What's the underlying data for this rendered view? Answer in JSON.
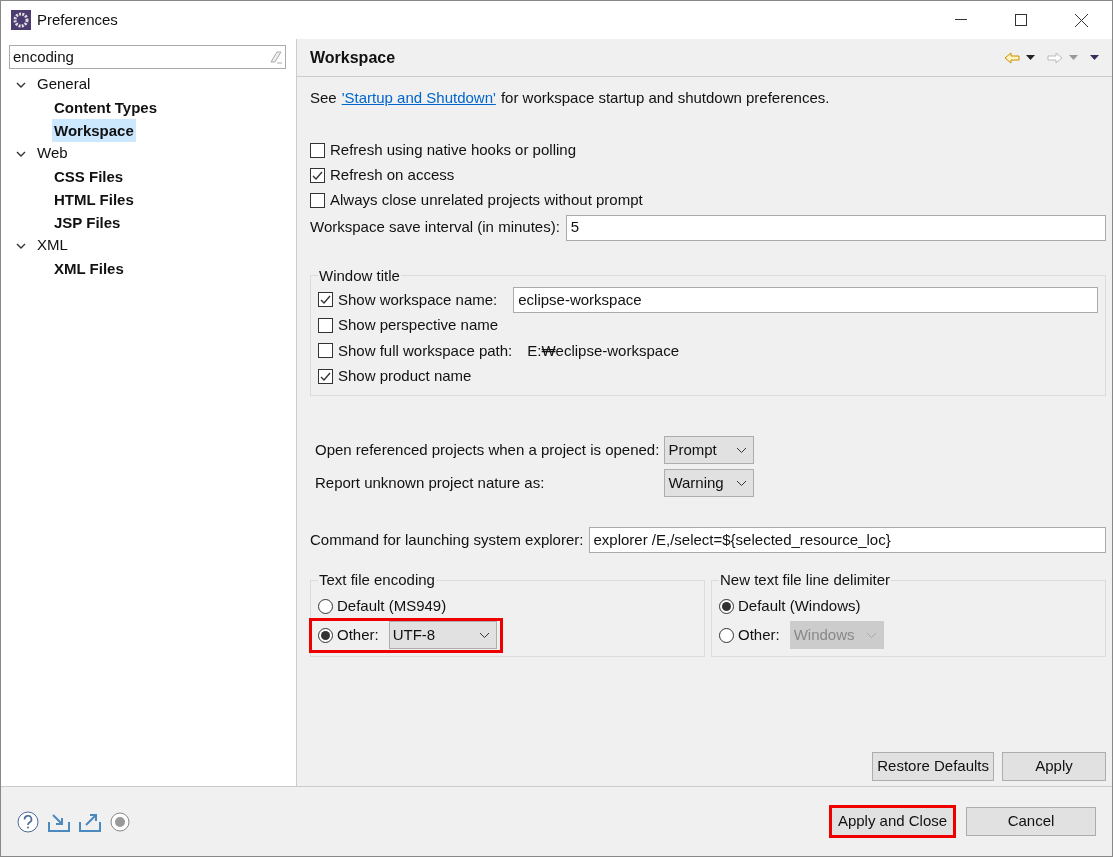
{
  "window": {
    "title": "Preferences"
  },
  "filter": {
    "value": "encoding"
  },
  "tree": [
    {
      "label": "General",
      "expanded": true,
      "selected": false,
      "children": [
        {
          "label": "Content Types",
          "selected": false
        },
        {
          "label": "Workspace",
          "selected": true
        }
      ]
    },
    {
      "label": "Web",
      "expanded": true,
      "selected": false,
      "children": [
        {
          "label": "CSS Files",
          "selected": false
        },
        {
          "label": "HTML Files",
          "selected": false
        },
        {
          "label": "JSP Files",
          "selected": false
        }
      ]
    },
    {
      "label": "XML",
      "expanded": true,
      "selected": false,
      "children": [
        {
          "label": "XML Files",
          "selected": false
        }
      ]
    }
  ],
  "page": {
    "title": "Workspace",
    "intro_before": "See",
    "intro_link": "'Startup and Shutdown'",
    "intro_after": "for workspace startup and shutdown preferences.",
    "checkboxes": [
      {
        "label": "Refresh using native hooks or polling",
        "checked": false
      },
      {
        "label": "Refresh on access",
        "checked": true
      },
      {
        "label": "Always close unrelated projects without prompt",
        "checked": false
      }
    ],
    "save_interval": {
      "label": "Workspace save interval (in minutes):",
      "value": "5"
    },
    "window_title": {
      "legend": "Window title",
      "options": [
        {
          "kind": "input",
          "label": "Show workspace name:",
          "checked": true,
          "value": "eclipse-workspace"
        },
        {
          "kind": "plain",
          "label": "Show perspective name",
          "checked": false
        },
        {
          "kind": "path",
          "label": "Show full workspace path:",
          "checked": false,
          "value": "E:₩eclipse-workspace"
        },
        {
          "kind": "plain",
          "label": "Show product name",
          "checked": true
        }
      ]
    },
    "selects": [
      {
        "label": "Open referenced projects when a project is opened:",
        "value": "Prompt"
      },
      {
        "label": "Report unknown project nature as:",
        "value": "Warning"
      }
    ],
    "explorer": {
      "label": "Command for launching system explorer:",
      "value": "explorer /E,/select=${selected_resource_loc}"
    },
    "encoding": {
      "legend": "Text file encoding",
      "options": [
        {
          "label": "Default (MS949)",
          "selected": false,
          "highlighted": false
        },
        {
          "label": "Other:",
          "selected": true,
          "value": "UTF-8",
          "disabled": false,
          "highlighted": true
        }
      ]
    },
    "delimiter": {
      "legend": "New text file line delimiter",
      "options": [
        {
          "label": "Default (Windows)",
          "selected": true,
          "highlighted": false
        },
        {
          "label": "Other:",
          "selected": false,
          "value": "Windows",
          "disabled": true,
          "highlighted": false
        }
      ]
    },
    "buttons": [
      "Restore Defaults",
      "Apply"
    ]
  },
  "footer": {
    "buttons": [
      {
        "label": "Apply and Close",
        "highlighted": true
      },
      {
        "label": "Cancel",
        "highlighted": false
      }
    ]
  }
}
